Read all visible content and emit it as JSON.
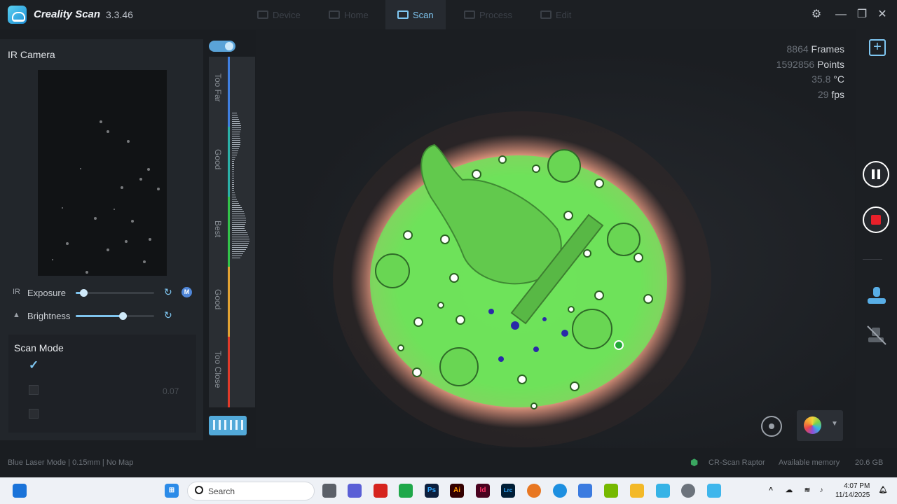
{
  "app": {
    "title": "Creality Scan",
    "version": "3.3.46"
  },
  "nav": {
    "tabs": [
      {
        "label": "Device",
        "active": false
      },
      {
        "label": "Home",
        "active": false
      },
      {
        "label": "Scan",
        "active": true
      },
      {
        "label": "Process",
        "active": false
      },
      {
        "label": "Edit",
        "active": false
      }
    ]
  },
  "left_panel": {
    "ir_title": "IR Camera",
    "exposure": {
      "label": "Exposure",
      "icon_text": "IR",
      "value_fraction": 0.1,
      "mode_badge": "M"
    },
    "brightness": {
      "label": "Brightness",
      "value_fraction": 0.6
    },
    "scan_mode": {
      "title": "Scan Mode",
      "options": [
        {
          "label": "",
          "checked": true
        },
        {
          "label": "",
          "checked": false,
          "value": "0.07"
        },
        {
          "label": "",
          "checked": false
        }
      ]
    }
  },
  "gauge": {
    "zones": [
      {
        "label": "Too Far",
        "color": "#3f7fe0"
      },
      {
        "label": "Good",
        "color": "#2bb0a8"
      },
      {
        "label": "Best",
        "color": "#33c24a"
      },
      {
        "label": "Good",
        "color": "#e2a233"
      },
      {
        "label": "Too Close",
        "color": "#e03a2a"
      }
    ]
  },
  "stats": [
    {
      "number": "8864",
      "unit": "Frames"
    },
    {
      "number": "1592856",
      "unit": "Points"
    },
    {
      "number": "35.8",
      "unit": "°C"
    },
    {
      "number": "29",
      "unit": "fps"
    }
  ],
  "status": {
    "left": "Blue Laser Mode | 0.15mm | No Map",
    "device": "CR-Scan Raptor",
    "memory_label": "Available memory",
    "memory_value": "20.6 GB"
  },
  "taskbar": {
    "search_placeholder": "Search",
    "time": "4:07 PM",
    "date": "11/14/2025",
    "apps": [
      "Ps",
      "Ai",
      "Id",
      "Lrc"
    ]
  }
}
